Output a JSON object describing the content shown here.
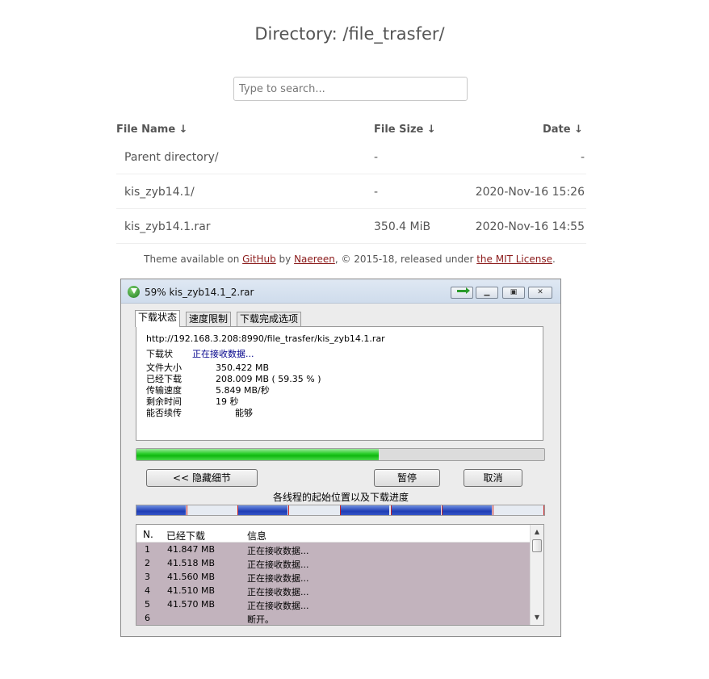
{
  "page": {
    "title": "Directory: /file_trasfer/",
    "search_placeholder": "Type to search...",
    "columns": {
      "name": "File Name  ↓",
      "size": "File Size  ↓",
      "date": "Date  ↓"
    },
    "rows": [
      {
        "name": "Parent directory/",
        "size": "-",
        "date": "-"
      },
      {
        "name": "kis_zyb14.1/",
        "size": "-",
        "date": "2020-Nov-16 15:26"
      },
      {
        "name": "kis_zyb14.1.rar",
        "size": "350.4 MiB",
        "date": "2020-Nov-16 14:55"
      }
    ],
    "footer": {
      "p1": "Theme available on ",
      "github": "GitHub",
      "p2": " by ",
      "author": "Naereen",
      "p3": ", © 2015-18, released under ",
      "license": "the MIT License",
      "p4": "."
    }
  },
  "dialog": {
    "title": "59% kis_zyb14.1_2.rar",
    "tabs": [
      "下载状态",
      "速度限制",
      "下载完成选项"
    ],
    "url": "http://192.168.3.208:8990/file_trasfer/kis_zyb14.1.rar",
    "status_label": "下载状",
    "status_value": "正在接收数据...",
    "details": [
      {
        "label": "文件大小",
        "value": "350.422  MB"
      },
      {
        "label": "已经下载",
        "value": "208.009  MB  ( 59.35 % )"
      },
      {
        "label": "传输速度",
        "value": "5.849  MB/秒"
      },
      {
        "label": "剩余时间",
        "value": "19 秒"
      },
      {
        "label": "能否续传",
        "value": "能够"
      }
    ],
    "progress_fraction": 0.5935,
    "buttons": {
      "hide_details": "<< 隐藏细节",
      "pause": "暂停",
      "cancel": "取消"
    },
    "threads_caption": "各线程的起始位置以及下载进度",
    "thread_segments": [
      {
        "done": 0.98
      },
      {
        "done": 0.0
      },
      {
        "done": 0.98
      },
      {
        "done": 0.0
      },
      {
        "done": 0.98
      },
      {
        "done": 0.98
      },
      {
        "done": 0.98
      },
      {
        "done": 0.0
      }
    ],
    "table": {
      "headers": {
        "n": "N.",
        "downloaded": "已经下载",
        "info": "信息"
      },
      "rows": [
        {
          "n": "1",
          "downloaded": "41.847  MB",
          "info": "正在接收数据..."
        },
        {
          "n": "2",
          "downloaded": "41.518  MB",
          "info": "正在接收数据..."
        },
        {
          "n": "3",
          "downloaded": "41.560  MB",
          "info": "正在接收数据..."
        },
        {
          "n": "4",
          "downloaded": "41.510  MB",
          "info": "正在接收数据..."
        },
        {
          "n": "5",
          "downloaded": "41.570  MB",
          "info": "正在接收数据..."
        },
        {
          "n": "6",
          "downloaded": "",
          "info": "断开。"
        }
      ]
    }
  }
}
